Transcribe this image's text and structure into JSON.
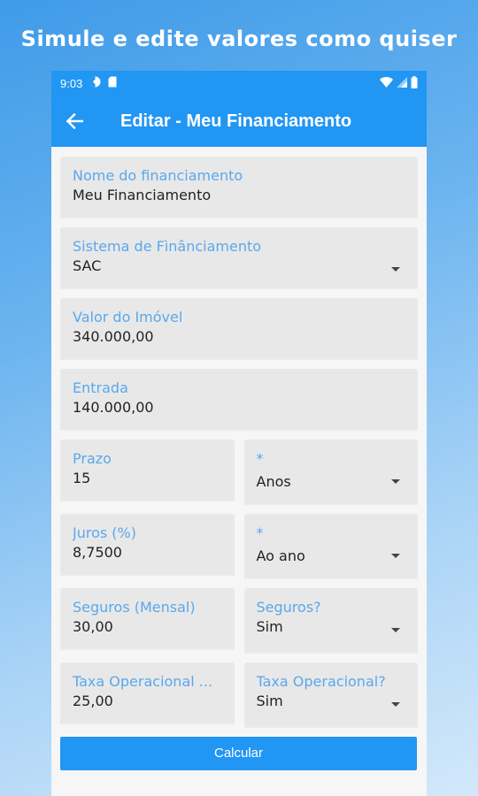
{
  "promo": {
    "headline": "Simule e edite valores como quiser"
  },
  "status": {
    "time": "9:03"
  },
  "app_bar": {
    "title": "Editar - Meu Financiamento"
  },
  "form": {
    "nome": {
      "label": "Nome do financiamento",
      "value": "Meu Financiamento"
    },
    "sistema": {
      "label": "Sistema de Fìnânciamento",
      "value": "SAC"
    },
    "valor_imovel": {
      "label": "Valor do Imóvel",
      "value": "340.000,00"
    },
    "entrada": {
      "label": "Entrada",
      "value": "140.000,00"
    },
    "prazo": {
      "label": "Prazo",
      "value": "15"
    },
    "prazo_unit": {
      "label": "*",
      "value": "Anos"
    },
    "juros": {
      "label": "Juros (%)",
      "value": "8,7500"
    },
    "juros_unit": {
      "label": "*",
      "value": "Ao ano"
    },
    "seguros": {
      "label": "Seguros (Mensal)",
      "value": "30,00"
    },
    "seguros_toggle": {
      "label": "Seguros?",
      "value": "Sim"
    },
    "taxa": {
      "label": "Taxa Operacional ...",
      "value": "25,00"
    },
    "taxa_toggle": {
      "label": "Taxa Operacional?",
      "value": "Sim"
    }
  },
  "actions": {
    "calculate_label": "Calcular"
  },
  "icons": {
    "back": "arrow-left-icon",
    "dropdown": "caret-down-icon",
    "wifi": "wifi-icon",
    "signal": "signal-icon",
    "battery": "battery-icon"
  },
  "colors": {
    "primary": "#2196f3",
    "label": "#5aa8ec",
    "field_bg": "#e8e8e8"
  }
}
